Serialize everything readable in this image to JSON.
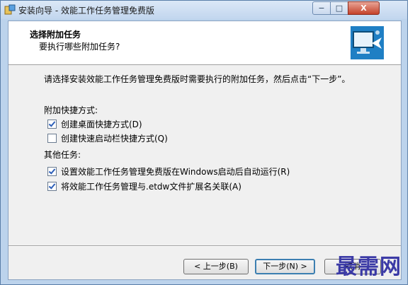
{
  "window": {
    "title": "安装向导 - 效能工作任务管理免费版",
    "controls": {
      "minimize": "−",
      "maximize": "□",
      "close": "X"
    }
  },
  "header": {
    "title": "选择附加任务",
    "subtitle": "要执行哪些附加任务?"
  },
  "instruction": "请选择安装效能工作任务管理免费版时需要执行的附加任务，然后点击“下一步”。",
  "groups": {
    "shortcuts_label": "附加快捷方式:",
    "other_label": "其他任务:"
  },
  "options": {
    "desktop_icon": {
      "label": "创建桌面快捷方式(D)",
      "checked": true
    },
    "quicklaunch_icon": {
      "label": "创建快速启动栏快捷方式(Q)",
      "checked": false
    },
    "autorun": {
      "label": "设置效能工作任务管理免费版在Windows启动后自动运行(R)",
      "checked": true
    },
    "file_assoc": {
      "label": "将效能工作任务管理与.etdw文件扩展名关联(A)",
      "checked": true
    }
  },
  "buttons": {
    "back": "< 上一步(B)",
    "next": "下一步(N) >",
    "cancel": "取消"
  },
  "watermark": "最需网",
  "icons": {
    "app": "installer-icon",
    "header": "monitor-arrow-icon"
  }
}
